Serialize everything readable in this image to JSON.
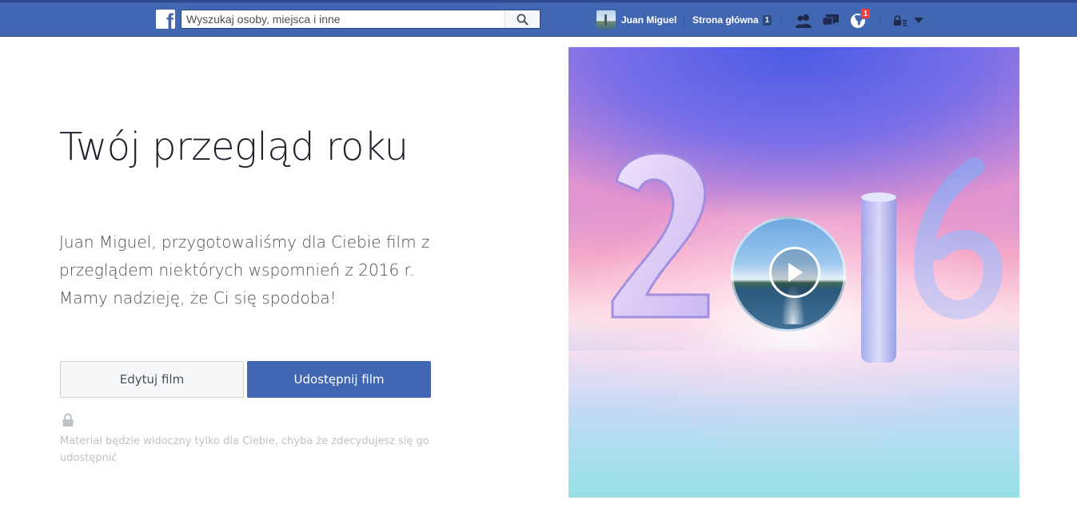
{
  "header": {
    "search_placeholder": "Wyszukaj osoby, miejsca i inne",
    "user_name": "Juan Miguel",
    "home_label": "Strona główna",
    "home_count": "1",
    "notifications_count": "1"
  },
  "main": {
    "title": "Twój przegląd roku",
    "intro": "Juan Miguel, przygotowaliśmy dla Ciebie film z przeglądem niektórych wspomnień z 2016 r. Mamy nadzieję, że Ci się spodoba!",
    "edit_label": "Edytuj film",
    "share_label": "Udostępnij film",
    "privacy_note": "Materiał będzie widoczny tylko dla Ciebie, chyba że zdecydujesz się go udostępnić"
  },
  "media": {
    "year_text": "2016"
  },
  "colors": {
    "brand": "#4267b2",
    "brand_dark": "#29487d",
    "notification": "#fa3e3e"
  },
  "icons": [
    "facebook-logo-icon",
    "search-icon",
    "friend-requests-icon",
    "messages-icon",
    "notifications-globe-icon",
    "privacy-lock-icon",
    "chevron-down-icon",
    "lock-icon",
    "play-icon"
  ]
}
